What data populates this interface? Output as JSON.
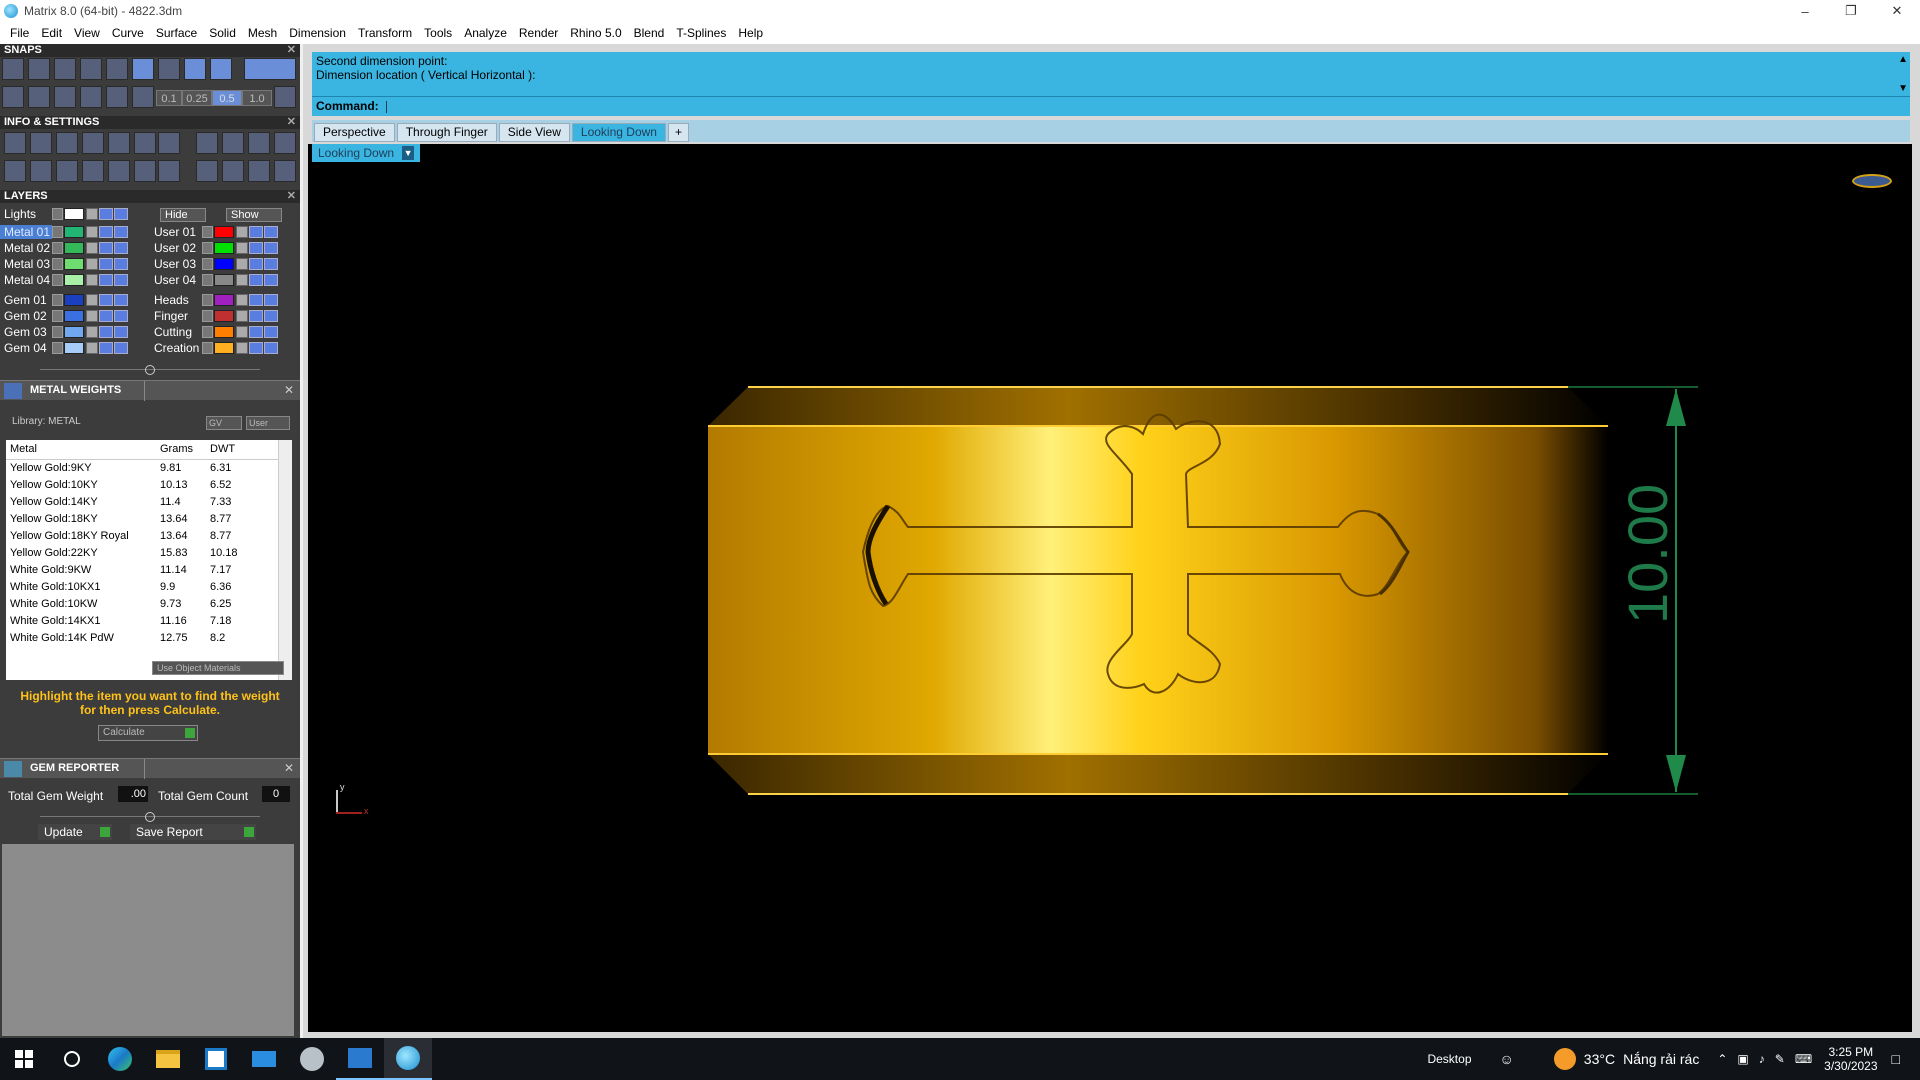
{
  "window": {
    "title": "Matrix 8.0 (64-bit) - 4822.3dm"
  },
  "menu": [
    "File",
    "Edit",
    "View",
    "Curve",
    "Surface",
    "Solid",
    "Mesh",
    "Dimension",
    "Transform",
    "Tools",
    "Analyze",
    "Render",
    "Rhino 5.0",
    "Blend",
    "T-Splines",
    "Help"
  ],
  "snaps": {
    "title": "SNAPS",
    "values": [
      "0.1",
      "0.25",
      "0.5",
      "1.0"
    ]
  },
  "info": {
    "title": "INFO & SETTINGS"
  },
  "layers": {
    "title": "LAYERS",
    "lights_label": "Lights",
    "hide_label": "Hide",
    "show_label": "Show",
    "left": [
      {
        "name": "Metal 01",
        "color": "#22b573",
        "selected": true
      },
      {
        "name": "Metal 02",
        "color": "#33b85a"
      },
      {
        "name": "Metal 03",
        "color": "#6fdc6f"
      },
      {
        "name": "Metal 04",
        "color": "#a8f0a8"
      },
      {
        "name": "Gem 01",
        "color": "#1a40c0"
      },
      {
        "name": "Gem 02",
        "color": "#3a70e0"
      },
      {
        "name": "Gem 03",
        "color": "#70a8f0"
      },
      {
        "name": "Gem 04",
        "color": "#a8ccf8"
      }
    ],
    "right": [
      {
        "name": "User 01",
        "color": "#ff0000"
      },
      {
        "name": "User 02",
        "color": "#00e000"
      },
      {
        "name": "User 03",
        "color": "#0000ff"
      },
      {
        "name": "User 04",
        "color": "#888888"
      },
      {
        "name": "Heads",
        "color": "#a020c0"
      },
      {
        "name": "Finger",
        "color": "#c03030"
      },
      {
        "name": "Cutting",
        "color": "#ff8000"
      },
      {
        "name": "Creation",
        "color": "#ffb020"
      }
    ]
  },
  "metal_weights": {
    "title": "METAL WEIGHTS",
    "library": "Library: METAL",
    "gv": "GV",
    "user": "User",
    "columns": [
      "Metal",
      "Grams",
      "DWT"
    ],
    "rows": [
      [
        "Yellow Gold:9KY",
        "9.81",
        "6.31"
      ],
      [
        "Yellow Gold:10KY",
        "10.13",
        "6.52"
      ],
      [
        "Yellow Gold:14KY",
        "11.4",
        "7.33"
      ],
      [
        "Yellow Gold:18KY",
        "13.64",
        "8.77"
      ],
      [
        "Yellow Gold:18KY Royal",
        "13.64",
        "8.77"
      ],
      [
        "Yellow Gold:22KY",
        "15.83",
        "10.18"
      ],
      [
        "White Gold:9KW",
        "11.14",
        "7.17"
      ],
      [
        "White Gold:10KX1",
        "9.9",
        "6.36"
      ],
      [
        "White Gold:10KW",
        "9.73",
        "6.25"
      ],
      [
        "White Gold:14KX1",
        "11.16",
        "7.18"
      ],
      [
        "White Gold:14K PdW",
        "12.75",
        "8.2"
      ]
    ],
    "use_object_materials": "Use Object Materials",
    "hint": "Highlight the item you want to find the weight for then press Calculate.",
    "calculate": "Calculate"
  },
  "gem_reporter": {
    "title": "GEM REPORTER",
    "total_weight_label": "Total Gem Weight",
    "total_weight": ".00",
    "total_count_label": "Total Gem Count",
    "total_count": "0",
    "update": "Update",
    "save_report": "Save Report"
  },
  "command": {
    "history": [
      "Second dimension point:",
      "Dimension location ( Vertical  Horizontal ):"
    ],
    "prompt": "Command:"
  },
  "tabs": [
    "Perspective",
    "Through Finger",
    "Side View",
    "Looking Down"
  ],
  "active_tab": "Looking Down",
  "viewport": {
    "label": "Looking Down",
    "dimension": "10.00",
    "axis_y": "y",
    "axis_x": "x"
  },
  "taskbar": {
    "desktop": "Desktop",
    "weather_temp": "33°C",
    "weather_text": "Nắng rải rác",
    "time": "3:25 PM",
    "date": "3/30/2023"
  }
}
